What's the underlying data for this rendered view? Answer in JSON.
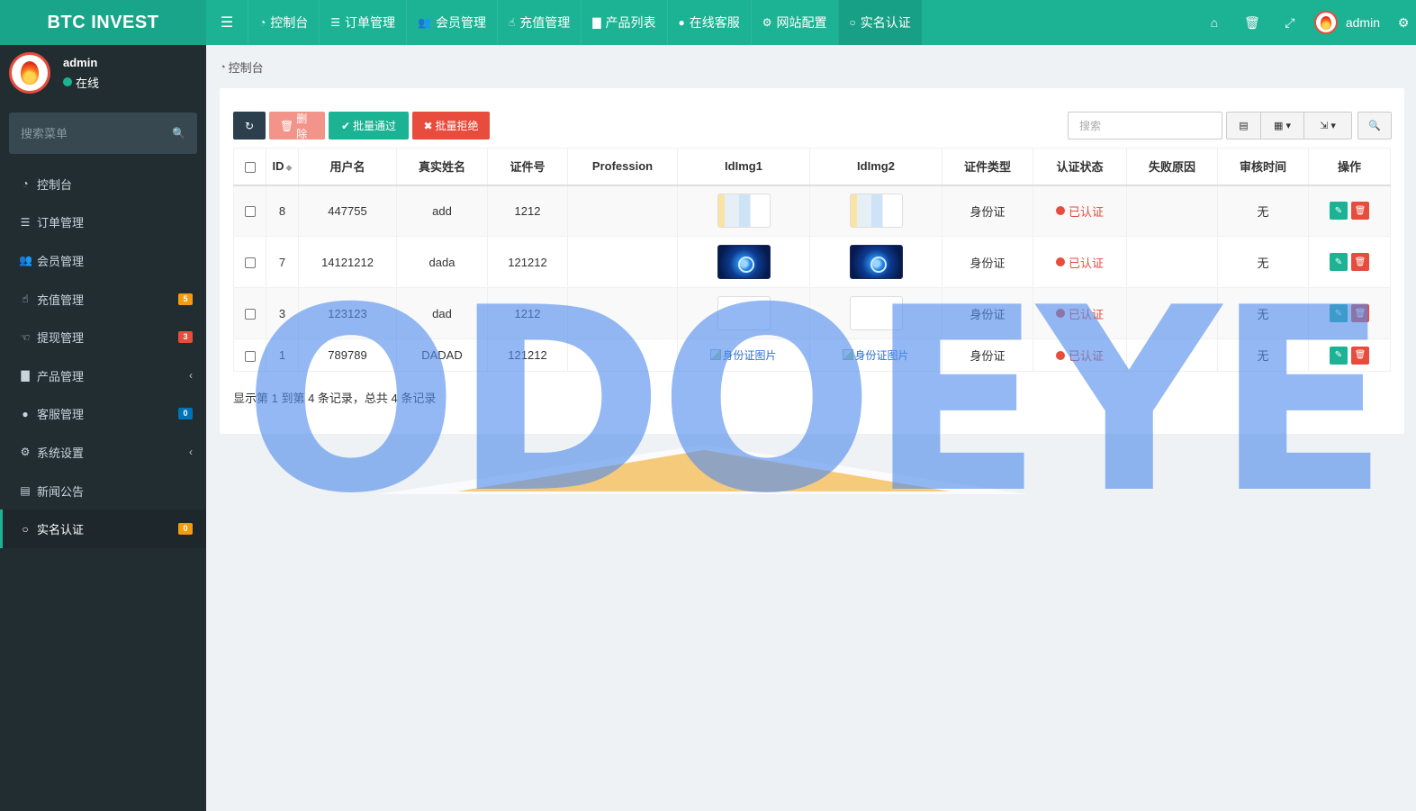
{
  "brand": "BTC INVEST",
  "topnav": [
    {
      "icon": "dashboard-icon",
      "label": "控制台"
    },
    {
      "icon": "list-icon",
      "label": "订单管理"
    },
    {
      "icon": "users-icon",
      "label": "会员管理"
    },
    {
      "icon": "hand-icon",
      "label": "充值管理"
    },
    {
      "icon": "bag-icon",
      "label": "产品列表"
    },
    {
      "icon": "chat-icon",
      "label": "在线客服"
    },
    {
      "icon": "gear-icon",
      "label": "网站配置"
    },
    {
      "icon": "circle-icon",
      "label": "实名认证"
    }
  ],
  "user": {
    "name": "admin",
    "status": "在线"
  },
  "sidebar": {
    "search_placeholder": "搜索菜单",
    "items": [
      {
        "icon": "dashboard-icon",
        "label": "控制台"
      },
      {
        "icon": "list-icon",
        "label": "订单管理"
      },
      {
        "icon": "users-icon",
        "label": "会员管理"
      },
      {
        "icon": "hand-icon",
        "label": "充值管理",
        "badge": "5",
        "badge_color": "#f39c12"
      },
      {
        "icon": "hand-icon",
        "label": "提现管理",
        "badge": "3",
        "badge_color": "#e74c3c"
      },
      {
        "icon": "bag-icon",
        "label": "产品管理"
      },
      {
        "icon": "chat-icon",
        "label": "客服管理",
        "badge": "0",
        "badge_color": "#0073b7"
      },
      {
        "icon": "gears-icon",
        "label": "系统设置"
      },
      {
        "icon": "news-icon",
        "label": "新闻公告"
      },
      {
        "icon": "circle-icon",
        "label": "实名认证",
        "badge": "0",
        "badge_color": "#f39c12"
      }
    ]
  },
  "breadcrumb": "控制台",
  "toolbar": {
    "delete": "删除",
    "batch_pass": "批量通过",
    "batch_reject": "批量拒绝",
    "search_placeholder": "搜索"
  },
  "table": {
    "headers": [
      "ID",
      "用户名",
      "真实姓名",
      "证件号",
      "Profession",
      "IdImg1",
      "IdImg2",
      "证件类型",
      "认证状态",
      "失败原因",
      "审核时间",
      "操作"
    ],
    "rows": [
      {
        "id": "8",
        "username": "447755",
        "realname": "add",
        "idno": "1212",
        "profession": "",
        "img1": "doc",
        "img2": "doc",
        "type": "身份证",
        "status": "已认证",
        "reason": "",
        "time": "无"
      },
      {
        "id": "7",
        "username": "14121212",
        "realname": "dada",
        "idno": "121212",
        "profession": "",
        "img1": "tech",
        "img2": "tech",
        "type": "身份证",
        "status": "已认证",
        "reason": "",
        "time": "无"
      },
      {
        "id": "3",
        "username": "123123",
        "realname": "dad",
        "idno": "1212",
        "profession": "",
        "img1": "blank",
        "img2": "blank",
        "type": "身份证",
        "status": "已认证",
        "reason": "",
        "time": "无"
      },
      {
        "id": "1",
        "username": "789789",
        "realname": "DADAD",
        "idno": "121212",
        "profession": "",
        "img1_alt": "身份证图片",
        "img2_alt": "身份证图片",
        "type": "身份证",
        "status": "已认证",
        "reason": "",
        "time": "无"
      }
    ]
  },
  "pagination_info": "显示第 1 到第 4 条记录，总共 4 条记录",
  "watermark": "ODOEYE",
  "colors": {
    "accent": "#1cb394",
    "danger": "#e74c3c",
    "sidebar": "#222d32"
  }
}
